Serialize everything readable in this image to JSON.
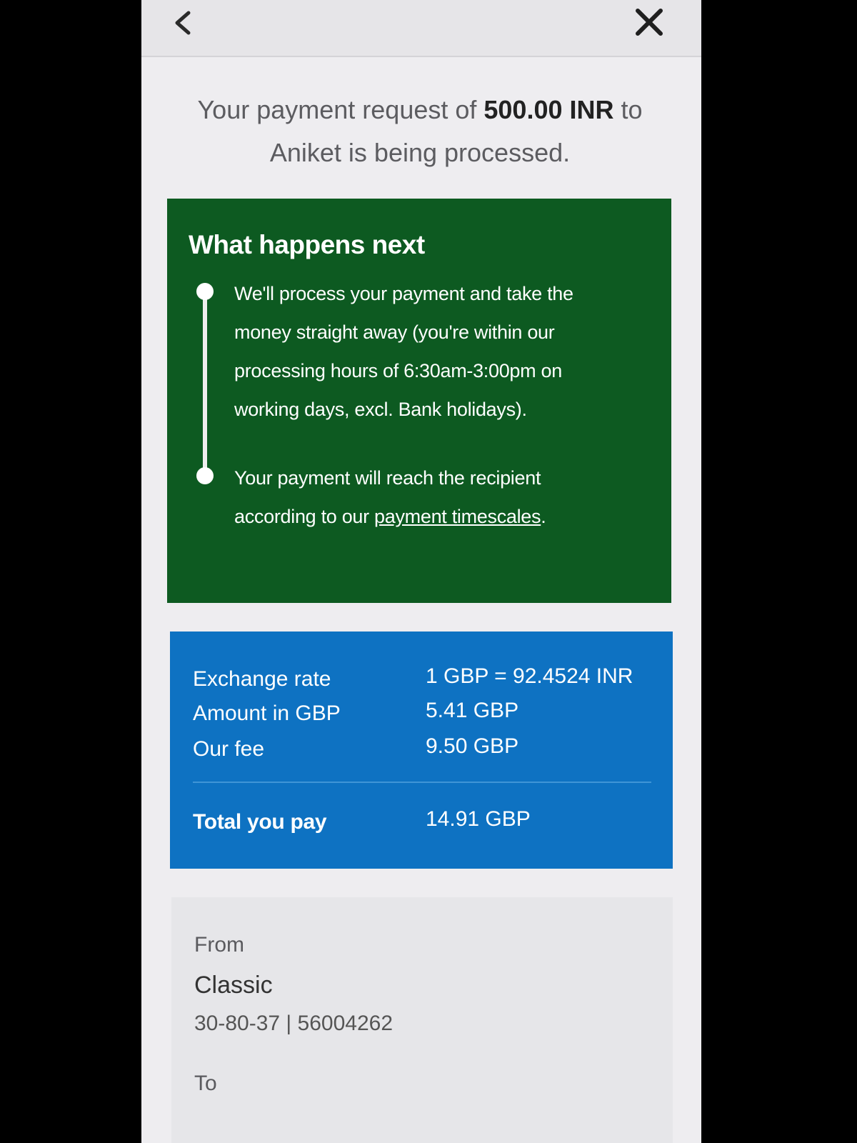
{
  "header": {
    "back_icon": "chevron-left-icon",
    "close_icon": "close-x-icon"
  },
  "confirmation": {
    "prefix": "Your payment request of ",
    "amount": "500.00 INR",
    "middle": " to",
    "line2": "Aniket is being processed."
  },
  "next_steps": {
    "title": "What happens next",
    "step1": "We'll process your payment and take the money straight away (you're within our processing hours of 6:30am-3:00pm on working days, excl. Bank holidays).",
    "step2_prefix": "Your payment will reach the recipient according to our ",
    "step2_link": "payment timescales",
    "step2_suffix": "."
  },
  "summary": {
    "exchange_rate_label": "Exchange rate",
    "exchange_rate_value": "1 GBP = 92.4524 INR",
    "amount_label": "Amount in GBP",
    "amount_value": "5.41 GBP",
    "fee_label": "Our fee",
    "fee_value": "9.50 GBP",
    "total_label": "Total you pay",
    "total_value": "14.91 GBP"
  },
  "account": {
    "from_label": "From",
    "from_name": "Classic",
    "from_number": "30-80-37 | 56004262",
    "to_label": "To"
  },
  "colors": {
    "green_card": "#0d5a21",
    "blue_card": "#0e72c2",
    "background": "#eeedf0"
  }
}
